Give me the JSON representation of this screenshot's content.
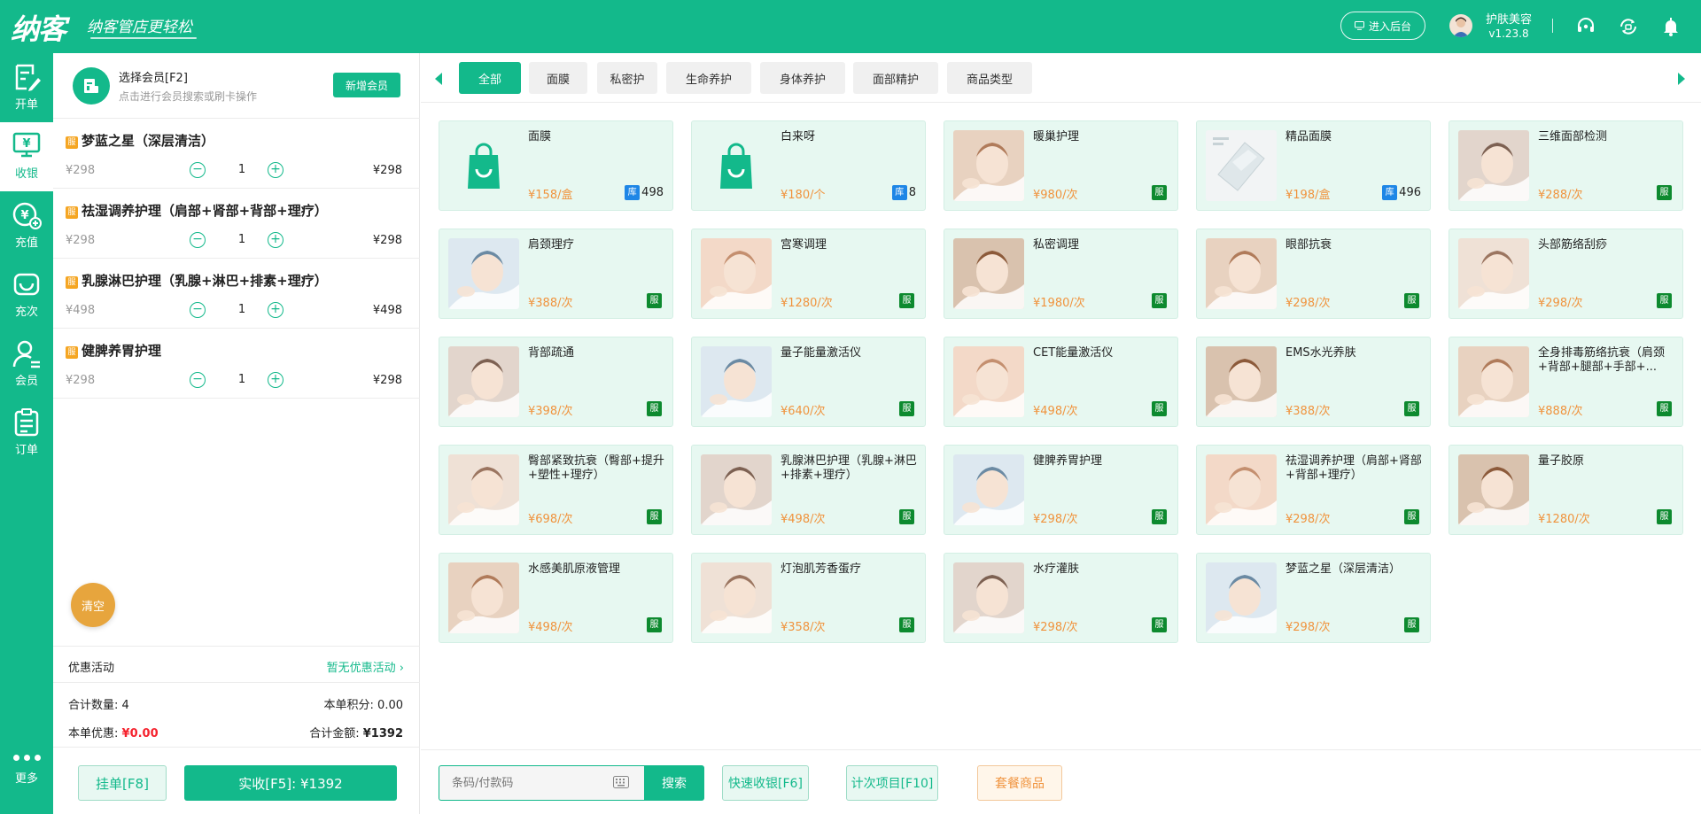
{
  "app": {
    "logo": "纳客",
    "slogan": "纳客管店更轻松",
    "backend_button": "进入后台",
    "shop_name": "护肤美容",
    "version": "v1.23.8"
  },
  "nav": {
    "items": [
      {
        "label": "开单",
        "icon": "edit-icon"
      },
      {
        "label": "收银",
        "icon": "cashier-icon"
      },
      {
        "label": "充值",
        "icon": "recharge-icon"
      },
      {
        "label": "充次",
        "icon": "recharge-times-icon"
      },
      {
        "label": "会员",
        "icon": "member-icon"
      },
      {
        "label": "订单",
        "icon": "order-icon"
      }
    ],
    "active": "收银",
    "more": "更多"
  },
  "member": {
    "title": "选择会员[F2]",
    "hint": "点击进行会员搜索或刷卡操作",
    "new_button": "新增会员"
  },
  "order_items": [
    {
      "badge": "服",
      "name": "梦蓝之星（深层清洁）",
      "price": "¥298",
      "qty": "1",
      "total": "¥298"
    },
    {
      "badge": "服",
      "name": "祛湿调养护理（肩部+肾部+背部+理疗）",
      "price": "¥298",
      "qty": "1",
      "total": "¥298"
    },
    {
      "badge": "服",
      "name": "乳腺淋巴护理（乳腺+淋巴+排素+理疗）",
      "price": "¥498",
      "qty": "1",
      "total": "¥498"
    },
    {
      "badge": "服",
      "name": "健脾养胃护理",
      "price": "¥298",
      "qty": "1",
      "total": "¥298"
    }
  ],
  "clear_button": "清空",
  "promo": {
    "label": "优惠活动",
    "value": "暂无优惠活动"
  },
  "summary": {
    "count_label": "合计数量:",
    "count": "4",
    "points_label": "本单积分:",
    "points": "0.00",
    "discount_label": "本单优惠:",
    "discount": "¥0.00",
    "amount_label": "合计金额:",
    "amount": "¥1392"
  },
  "actions": {
    "hold": "挂单[F8]",
    "pay": "实收[F5]: ¥1392"
  },
  "categories": [
    "全部",
    "面膜",
    "私密护",
    "生命养护",
    "身体养护",
    "面部精护",
    "商品类型"
  ],
  "active_category": "全部",
  "products": [
    {
      "name": "面膜",
      "price": "¥158/盒",
      "kind": "stock",
      "badge": "库",
      "stock": "498",
      "thumb": "bag"
    },
    {
      "name": "白来呀",
      "price": "¥180/个",
      "kind": "stock",
      "badge": "库",
      "stock": "8",
      "thumb": "bag"
    },
    {
      "name": "暖巢护理",
      "price": "¥980/次",
      "kind": "service",
      "badge": "服",
      "thumb": "photo"
    },
    {
      "name": "精品面膜",
      "price": "¥198/盒",
      "kind": "stock",
      "badge": "库",
      "stock": "496",
      "thumb": "mask"
    },
    {
      "name": "三维面部检测",
      "price": "¥288/次",
      "kind": "service",
      "badge": "服",
      "thumb": "photo"
    },
    {
      "name": "肩颈理疗",
      "price": "¥388/次",
      "kind": "service",
      "badge": "服",
      "thumb": "photo"
    },
    {
      "name": "宫寒调理",
      "price": "¥1280/次",
      "kind": "service",
      "badge": "服",
      "thumb": "photo"
    },
    {
      "name": "私密调理",
      "price": "¥1980/次",
      "kind": "service",
      "badge": "服",
      "thumb": "photo"
    },
    {
      "name": "眼部抗衰",
      "price": "¥298/次",
      "kind": "service",
      "badge": "服",
      "thumb": "photo"
    },
    {
      "name": "头部筋络刮痧",
      "price": "¥298/次",
      "kind": "service",
      "badge": "服",
      "thumb": "photo"
    },
    {
      "name": "背部疏通",
      "price": "¥398/次",
      "kind": "service",
      "badge": "服",
      "thumb": "photo"
    },
    {
      "name": "量子能量激活仪",
      "price": "¥640/次",
      "kind": "service",
      "badge": "服",
      "thumb": "photo"
    },
    {
      "name": "CET能量激活仪",
      "price": "¥498/次",
      "kind": "service",
      "badge": "服",
      "thumb": "photo"
    },
    {
      "name": "EMS水光养肤",
      "price": "¥388/次",
      "kind": "service",
      "badge": "服",
      "thumb": "photo"
    },
    {
      "name": "全身排毒筋络抗衰（肩颈+背部+腿部+手部+...",
      "price": "¥888/次",
      "kind": "service",
      "badge": "服",
      "thumb": "photo"
    },
    {
      "name": "臀部紧致抗衰（臀部+提升+塑性+理疗）",
      "price": "¥698/次",
      "kind": "service",
      "badge": "服",
      "thumb": "photo"
    },
    {
      "name": "乳腺淋巴护理（乳腺+淋巴+排素+理疗）",
      "price": "¥498/次",
      "kind": "service",
      "badge": "服",
      "thumb": "photo"
    },
    {
      "name": "健脾养胃护理",
      "price": "¥298/次",
      "kind": "service",
      "badge": "服",
      "thumb": "photo"
    },
    {
      "name": "祛湿调养护理（肩部+肾部+背部+理疗）",
      "price": "¥298/次",
      "kind": "service",
      "badge": "服",
      "thumb": "photo"
    },
    {
      "name": "量子胶原",
      "price": "¥1280/次",
      "kind": "service",
      "badge": "服",
      "thumb": "photo"
    },
    {
      "name": "水感美肌原液管理",
      "price": "¥498/次",
      "kind": "service",
      "badge": "服",
      "thumb": "photo"
    },
    {
      "name": "灯泡肌芳香蛋疗",
      "price": "¥358/次",
      "kind": "service",
      "badge": "服",
      "thumb": "photo"
    },
    {
      "name": "水疗灌肤",
      "price": "¥298/次",
      "kind": "service",
      "badge": "服",
      "thumb": "photo"
    },
    {
      "name": "梦蓝之星（深层清洁）",
      "price": "¥298/次",
      "kind": "service",
      "badge": "服",
      "thumb": "photo"
    }
  ],
  "bottom": {
    "search_placeholder": "条码/付款码",
    "search_button": "搜索",
    "quick_checkout": "快速收银[F6]",
    "times_item": "计次项目[F10]",
    "package_goods": "套餐商品"
  },
  "colors": {
    "brand": "#13b98b",
    "price": "#f0933d",
    "service_badge": "#0d8a2f",
    "stock_badge": "#1e86e6",
    "clear_button": "#e7a53d",
    "card_bg": "#e7f8f1"
  }
}
